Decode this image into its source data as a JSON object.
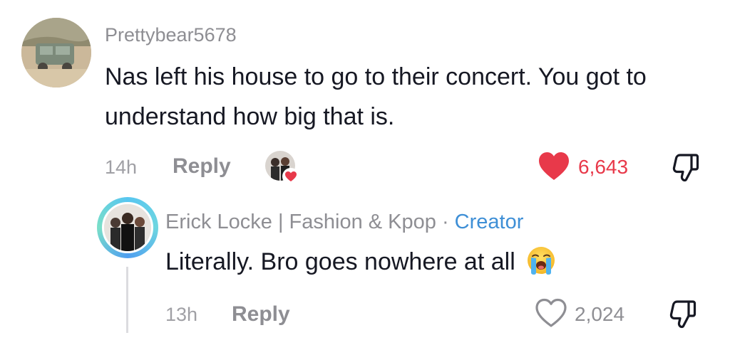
{
  "comment": {
    "username": "Prettybear5678",
    "text": "Nas left his house to go to their concert. You got to understand how big that is.",
    "time": "14h",
    "reply_label": "Reply",
    "likes": "6,643",
    "liked": true,
    "creator_liked": true
  },
  "reply": {
    "username": "Erick Locke | Fashion & Kpop",
    "separator": " · ",
    "badge": "Creator",
    "text": "Literally. Bro goes nowhere at all",
    "emoji": "loudly-crying-face",
    "time": "13h",
    "reply_label": "Reply",
    "likes": "2,024",
    "liked": false
  },
  "colors": {
    "text_primary": "#161823",
    "text_secondary": "#8e8e93",
    "like_active": "#e8394a",
    "creator_badge": "#3e8fd6"
  }
}
